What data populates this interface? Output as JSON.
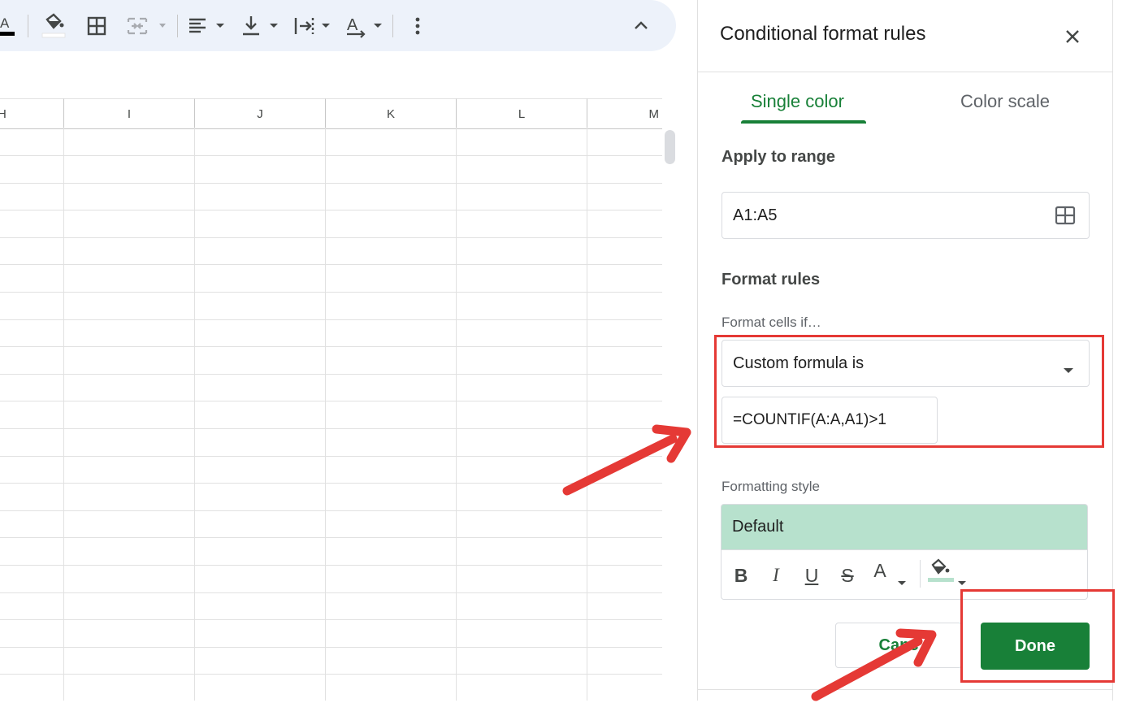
{
  "toolbar": {
    "icons": [
      "text-color-icon",
      "fill-color-icon",
      "borders-icon",
      "merge-cells-icon",
      "horizontal-align-icon",
      "vertical-align-icon",
      "text-wrap-icon",
      "text-rotation-icon",
      "more-options-icon",
      "collapse-toolbar-icon"
    ]
  },
  "sheet": {
    "columns": [
      "H",
      "I",
      "J",
      "K",
      "L",
      "M"
    ]
  },
  "panel": {
    "title": "Conditional format rules",
    "tabs": [
      "Single color",
      "Color scale"
    ],
    "active_tab": "Single color",
    "apply_to_range_label": "Apply to range",
    "range_value": "A1:A5",
    "format_rules_label": "Format rules",
    "format_cells_if_label": "Format cells if…",
    "condition_value": "Custom formula is",
    "formula_value": "=COUNTIF(A:A,A1)>1",
    "formatting_style_label": "Formatting style",
    "style_preview": "Default",
    "style_buttons": [
      "B",
      "I",
      "U",
      "S",
      "A"
    ],
    "cancel_label": "Canc",
    "done_label": "Done"
  },
  "colors": {
    "accent": "#188038",
    "style_preview_bg": "#b7e1cd",
    "annotation": "#e53935",
    "toolbar_bg": "#edf2fa"
  }
}
